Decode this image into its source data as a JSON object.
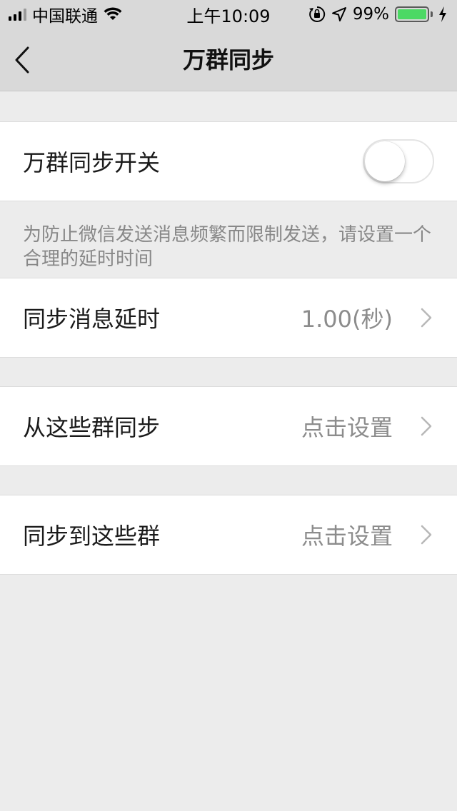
{
  "status_bar": {
    "carrier": "中国联通",
    "time": "上午10:09",
    "battery_percent": "99%",
    "battery_level": 0.99,
    "icons": [
      "signal-icon",
      "wifi-icon",
      "orientation-lock-icon",
      "location-icon",
      "battery-icon",
      "charging-icon"
    ]
  },
  "nav": {
    "title": "万群同步",
    "back_icon": "chevron-left-icon"
  },
  "sync_switch": {
    "label": "万群同步开关",
    "enabled": false
  },
  "hint": "为防止微信发送消息频繁而限制发送，请设置一个合理的延时时间",
  "settings": {
    "delay": {
      "label": "同步消息延时",
      "value": "1.00(秒)"
    },
    "from_groups": {
      "label": "从这些群同步",
      "value": "点击设置"
    },
    "to_groups": {
      "label": "同步到这些群",
      "value": "点击设置"
    }
  },
  "colors": {
    "bar_background": "#d9d9d9",
    "page_background": "#ececec",
    "battery_fill": "#4cd964",
    "secondary_text": "#8c8c8c"
  }
}
